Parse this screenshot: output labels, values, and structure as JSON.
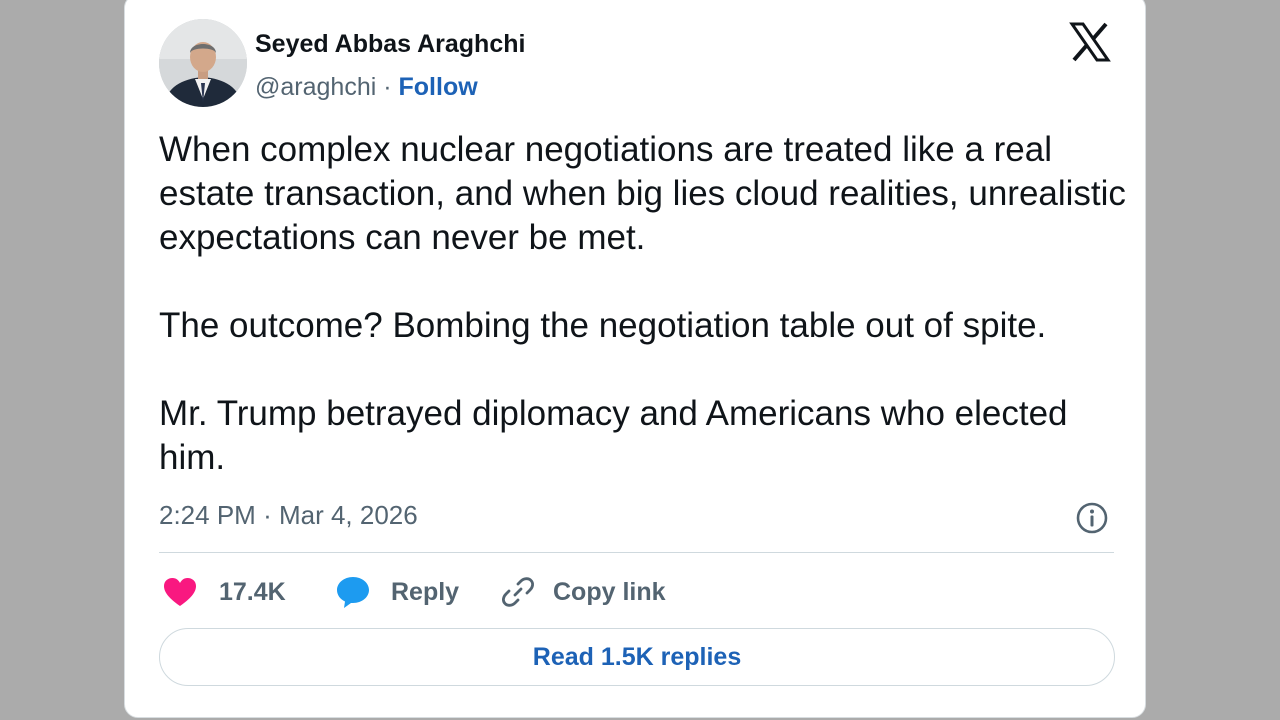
{
  "author": {
    "display_name": "Seyed Abbas Araghchi",
    "handle": "@araghchi",
    "separator": "·",
    "follow_label": "Follow"
  },
  "tweet": {
    "paragraphs": [
      "When complex nuclear negotiations are treated like a real estate transaction, and when big lies cloud realities, unrealistic expectations can never be met.",
      "The outcome? Bombing the negotiation table out of spite.",
      "Mr. Trump betrayed diplomacy and Americans who elected him."
    ],
    "time": "2:24 PM",
    "date_separator": "·",
    "date": "Mar 4, 2026"
  },
  "actions": {
    "like_count": "17.4K",
    "reply_label": "Reply",
    "copy_link_label": "Copy link",
    "read_replies_label": "Read 1.5K replies"
  },
  "icons": {
    "logo": "x-logo-icon",
    "info": "info-icon",
    "like": "heart-icon",
    "reply": "speech-bubble-icon",
    "copy": "link-icon"
  },
  "colors": {
    "accent": "#1d62b6",
    "heart": "#f91880",
    "reply_bubble": "#1d9bf0",
    "text": "#0f1419",
    "muted": "#536471",
    "backdrop": "#ababab"
  }
}
